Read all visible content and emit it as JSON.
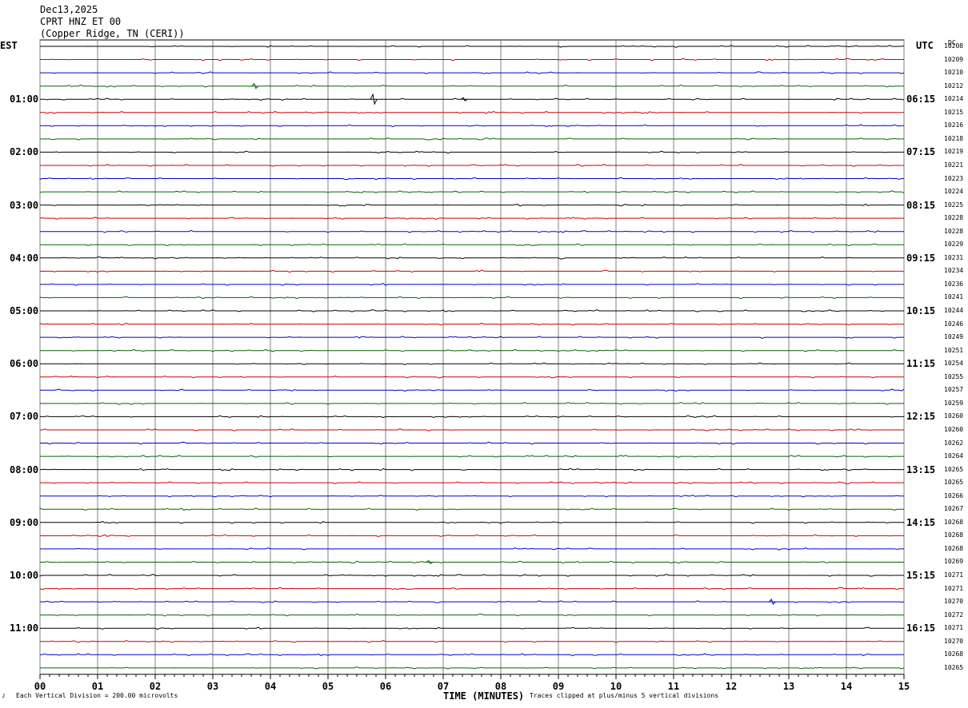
{
  "header": {
    "date": "Dec13,2025",
    "station": "CPRT HNZ ET 00",
    "location": "(Copper Ridge, TN (CERI))"
  },
  "left_label": "EST",
  "right_label": "UTC",
  "dc_label": "DC",
  "footer": {
    "left_mark": "ᴊ",
    "scale_note": "Each Vertical Division =  200.00 microvolts",
    "clip_note": "Traces clipped at plus/minus 5 vertical divisions"
  },
  "colors": {
    "trace_cycle": [
      "#000000",
      "#cc0000",
      "#0000cc",
      "#006600"
    ],
    "grid": "#808080"
  },
  "chart_data": {
    "type": "line",
    "title": "",
    "xlabel": "TIME (MINUTES)",
    "ylabel": "",
    "xlim": [
      0,
      15
    ],
    "x_ticks": [
      "00",
      "01",
      "02",
      "03",
      "04",
      "05",
      "06",
      "07",
      "08",
      "09",
      "10",
      "11",
      "12",
      "13",
      "14",
      "15"
    ],
    "grid": true,
    "left_time_labels": [
      "01:00",
      "02:00",
      "03:00",
      "04:00",
      "05:00",
      "06:00",
      "07:00",
      "08:00",
      "09:00",
      "10:00",
      "11:00"
    ],
    "right_time_labels": [
      "06:15",
      "07:15",
      "08:15",
      "09:15",
      "10:15",
      "11:15",
      "12:15",
      "13:15",
      "14:15",
      "15:15",
      "16:15"
    ],
    "dc_offsets": [
      "10208",
      "10209",
      "10210",
      "10212",
      "10214",
      "10215",
      "10216",
      "10218",
      "10219",
      "10221",
      "10223",
      "10224",
      "10225",
      "10228",
      "10228",
      "10229",
      "10231",
      "10234",
      "10236",
      "10241",
      "10244",
      "10246",
      "10249",
      "10251",
      "10254",
      "10255",
      "10257",
      "10259",
      "10260",
      "10260",
      "10262",
      "10264",
      "10265",
      "10265",
      "10266",
      "10267",
      "10268",
      "10268",
      "10268",
      "10269",
      "10271",
      "10271",
      "10270",
      "10272",
      "10271",
      "10270",
      "10268",
      "10265"
    ],
    "events": [
      {
        "trace": 3,
        "minute": 3.72,
        "amplitude": 3
      },
      {
        "trace": 4,
        "minute": 5.78,
        "amplitude": 6
      },
      {
        "trace": 4,
        "minute": 7.35,
        "amplitude": 2
      },
      {
        "trace": 39,
        "minute": 6.75,
        "amplitude": 2
      },
      {
        "trace": 42,
        "minute": 12.7,
        "amplitude": 3
      }
    ]
  }
}
